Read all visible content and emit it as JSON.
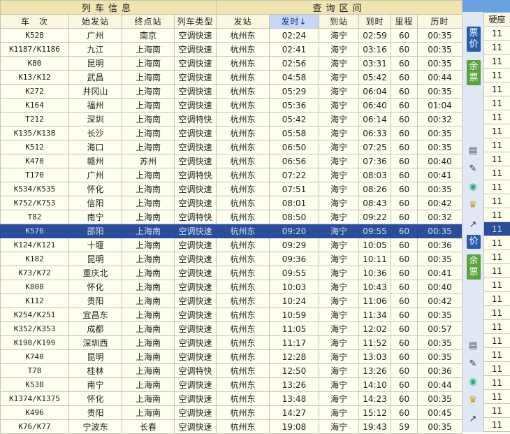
{
  "groups": {
    "train_info": "列车信息",
    "query_section": "查询区间"
  },
  "headers": [
    "车　次",
    "始发站",
    "终点站",
    "列车类型",
    "发站",
    "发时↓",
    "到站",
    "到时",
    "里程",
    "历时"
  ],
  "extra_header": "硬座",
  "selected_index": 14,
  "rows": [
    {
      "code": "K528",
      "from": "广州",
      "to": "南京",
      "type": "空调快速",
      "dep_st": "杭州东",
      "dep": "02:24",
      "arr_st": "海宁",
      "arr": "02:59",
      "km": "60",
      "dur": "00:35",
      "seat": "11"
    },
    {
      "code": "K1187/K1186",
      "from": "九江",
      "to": "上海南",
      "type": "空调快速",
      "dep_st": "杭州东",
      "dep": "02:41",
      "arr_st": "海宁",
      "arr": "03:16",
      "km": "60",
      "dur": "00:35",
      "seat": "11"
    },
    {
      "code": "K80",
      "from": "昆明",
      "to": "上海南",
      "type": "空调快速",
      "dep_st": "杭州东",
      "dep": "02:56",
      "arr_st": "海宁",
      "arr": "03:31",
      "km": "60",
      "dur": "00:35",
      "seat": "11"
    },
    {
      "code": "K13/K12",
      "from": "武昌",
      "to": "上海南",
      "type": "空调快速",
      "dep_st": "杭州东",
      "dep": "04:58",
      "arr_st": "海宁",
      "arr": "05:42",
      "km": "60",
      "dur": "00:44",
      "seat": "11"
    },
    {
      "code": "K272",
      "from": "井冈山",
      "to": "上海南",
      "type": "空调快速",
      "dep_st": "杭州东",
      "dep": "05:29",
      "arr_st": "海宁",
      "arr": "06:04",
      "km": "60",
      "dur": "00:35",
      "seat": "11"
    },
    {
      "code": "K164",
      "from": "福州",
      "to": "上海南",
      "type": "空调快速",
      "dep_st": "杭州东",
      "dep": "05:36",
      "arr_st": "海宁",
      "arr": "06:40",
      "km": "60",
      "dur": "01:04",
      "seat": "11"
    },
    {
      "code": "T212",
      "from": "深圳",
      "to": "上海南",
      "type": "空调特快",
      "dep_st": "杭州东",
      "dep": "05:42",
      "arr_st": "海宁",
      "arr": "06:14",
      "km": "60",
      "dur": "00:32",
      "seat": "11"
    },
    {
      "code": "K135/K138",
      "from": "长沙",
      "to": "上海南",
      "type": "空调快速",
      "dep_st": "杭州东",
      "dep": "05:58",
      "arr_st": "海宁",
      "arr": "06:33",
      "km": "60",
      "dur": "00:35",
      "seat": "11"
    },
    {
      "code": "K512",
      "from": "海口",
      "to": "上海南",
      "type": "空调快速",
      "dep_st": "杭州东",
      "dep": "06:50",
      "arr_st": "海宁",
      "arr": "07:25",
      "km": "60",
      "dur": "00:35",
      "seat": "11"
    },
    {
      "code": "K470",
      "from": "赣州",
      "to": "苏州",
      "type": "空调快速",
      "dep_st": "杭州东",
      "dep": "06:56",
      "arr_st": "海宁",
      "arr": "07:36",
      "km": "60",
      "dur": "00:40",
      "seat": "11"
    },
    {
      "code": "T170",
      "from": "广州",
      "to": "上海南",
      "type": "空调特快",
      "dep_st": "杭州东",
      "dep": "07:22",
      "arr_st": "海宁",
      "arr": "08:03",
      "km": "60",
      "dur": "00:41",
      "seat": "11"
    },
    {
      "code": "K534/K535",
      "from": "怀化",
      "to": "上海南",
      "type": "空调快速",
      "dep_st": "杭州东",
      "dep": "07:51",
      "arr_st": "海宁",
      "arr": "08:26",
      "km": "60",
      "dur": "00:35",
      "seat": "11"
    },
    {
      "code": "K752/K753",
      "from": "信阳",
      "to": "上海南",
      "type": "空调快速",
      "dep_st": "杭州东",
      "dep": "08:01",
      "arr_st": "海宁",
      "arr": "08:43",
      "km": "60",
      "dur": "00:42",
      "seat": "11"
    },
    {
      "code": "T82",
      "from": "南宁",
      "to": "上海南",
      "type": "空调特快",
      "dep_st": "杭州东",
      "dep": "08:50",
      "arr_st": "海宁",
      "arr": "09:22",
      "km": "60",
      "dur": "00:32",
      "seat": "11"
    },
    {
      "code": "K576",
      "from": "邵阳",
      "to": "上海南",
      "type": "空调快速",
      "dep_st": "杭州东",
      "dep": "09:20",
      "arr_st": "海宁",
      "arr": "09:55",
      "km": "60",
      "dur": "00:35",
      "seat": "11"
    },
    {
      "code": "K124/K121",
      "from": "十堰",
      "to": "上海南",
      "type": "空调快速",
      "dep_st": "杭州东",
      "dep": "09:29",
      "arr_st": "海宁",
      "arr": "10:05",
      "km": "60",
      "dur": "00:36",
      "seat": "11"
    },
    {
      "code": "K182",
      "from": "昆明",
      "to": "上海南",
      "type": "空调快速",
      "dep_st": "杭州东",
      "dep": "09:36",
      "arr_st": "海宁",
      "arr": "10:11",
      "km": "60",
      "dur": "00:35",
      "seat": "11"
    },
    {
      "code": "K73/K72",
      "from": "重庆北",
      "to": "上海南",
      "type": "空调快速",
      "dep_st": "杭州东",
      "dep": "09:55",
      "arr_st": "海宁",
      "arr": "10:36",
      "km": "60",
      "dur": "00:41",
      "seat": "11"
    },
    {
      "code": "K808",
      "from": "怀化",
      "to": "上海南",
      "type": "空调快速",
      "dep_st": "杭州东",
      "dep": "10:03",
      "arr_st": "海宁",
      "arr": "10:43",
      "km": "60",
      "dur": "00:40",
      "seat": "11"
    },
    {
      "code": "K112",
      "from": "贵阳",
      "to": "上海南",
      "type": "空调快速",
      "dep_st": "杭州东",
      "dep": "10:24",
      "arr_st": "海宁",
      "arr": "11:06",
      "km": "60",
      "dur": "00:42",
      "seat": "11"
    },
    {
      "code": "K254/K251",
      "from": "宜昌东",
      "to": "上海南",
      "type": "空调快速",
      "dep_st": "杭州东",
      "dep": "10:59",
      "arr_st": "海宁",
      "arr": "11:34",
      "km": "60",
      "dur": "00:35",
      "seat": "11"
    },
    {
      "code": "K352/K353",
      "from": "成都",
      "to": "上海南",
      "type": "空调快速",
      "dep_st": "杭州东",
      "dep": "11:05",
      "arr_st": "海宁",
      "arr": "12:02",
      "km": "60",
      "dur": "00:57",
      "seat": "11"
    },
    {
      "code": "K198/K199",
      "from": "深圳西",
      "to": "上海南",
      "type": "空调快速",
      "dep_st": "杭州东",
      "dep": "11:17",
      "arr_st": "海宁",
      "arr": "11:52",
      "km": "60",
      "dur": "00:35",
      "seat": "11"
    },
    {
      "code": "K740",
      "from": "昆明",
      "to": "上海南",
      "type": "空调快速",
      "dep_st": "杭州东",
      "dep": "12:28",
      "arr_st": "海宁",
      "arr": "13:03",
      "km": "60",
      "dur": "00:35",
      "seat": "11"
    },
    {
      "code": "T78",
      "from": "桂林",
      "to": "上海南",
      "type": "空调特快",
      "dep_st": "杭州东",
      "dep": "12:50",
      "arr_st": "海宁",
      "arr": "13:26",
      "km": "60",
      "dur": "00:36",
      "seat": "11"
    },
    {
      "code": "K538",
      "from": "南宁",
      "to": "上海南",
      "type": "空调快速",
      "dep_st": "杭州东",
      "dep": "13:26",
      "arr_st": "海宁",
      "arr": "14:10",
      "km": "60",
      "dur": "00:44",
      "seat": "11"
    },
    {
      "code": "K1374/K1375",
      "from": "怀化",
      "to": "上海南",
      "type": "空调快速",
      "dep_st": "杭州东",
      "dep": "13:48",
      "arr_st": "海宁",
      "arr": "14:23",
      "km": "60",
      "dur": "00:35",
      "seat": "11"
    },
    {
      "code": "K496",
      "from": "贵阳",
      "to": "上海南",
      "type": "空调快速",
      "dep_st": "杭州东",
      "dep": "14:27",
      "arr_st": "海宁",
      "arr": "15:12",
      "km": "60",
      "dur": "00:45",
      "seat": "11"
    },
    {
      "code": "K76/K77",
      "from": "宁波东",
      "to": "长春",
      "type": "空调快速",
      "dep_st": "杭州东",
      "dep": "19:08",
      "arr_st": "海宁",
      "arr": "19:43",
      "km": "59",
      "dur": "00:35",
      "seat": "11"
    }
  ],
  "sidebar": {
    "fare_button": [
      "票",
      "价"
    ],
    "remaining_button": [
      "余",
      "票"
    ],
    "fare_button_2": "价",
    "remaining_button_2": [
      "余",
      "票"
    ],
    "tool_icons": [
      "note-icon",
      "edit-icon",
      "media-icon",
      "crown-icon",
      "arrow-icon"
    ]
  },
  "colors": {
    "header_group": "#f2e4b0",
    "selected_row": "#2b4e9a",
    "sorted_header": "#c6d6f4",
    "button_blue": "#2a5cab",
    "button_green": "#5aa33c"
  }
}
